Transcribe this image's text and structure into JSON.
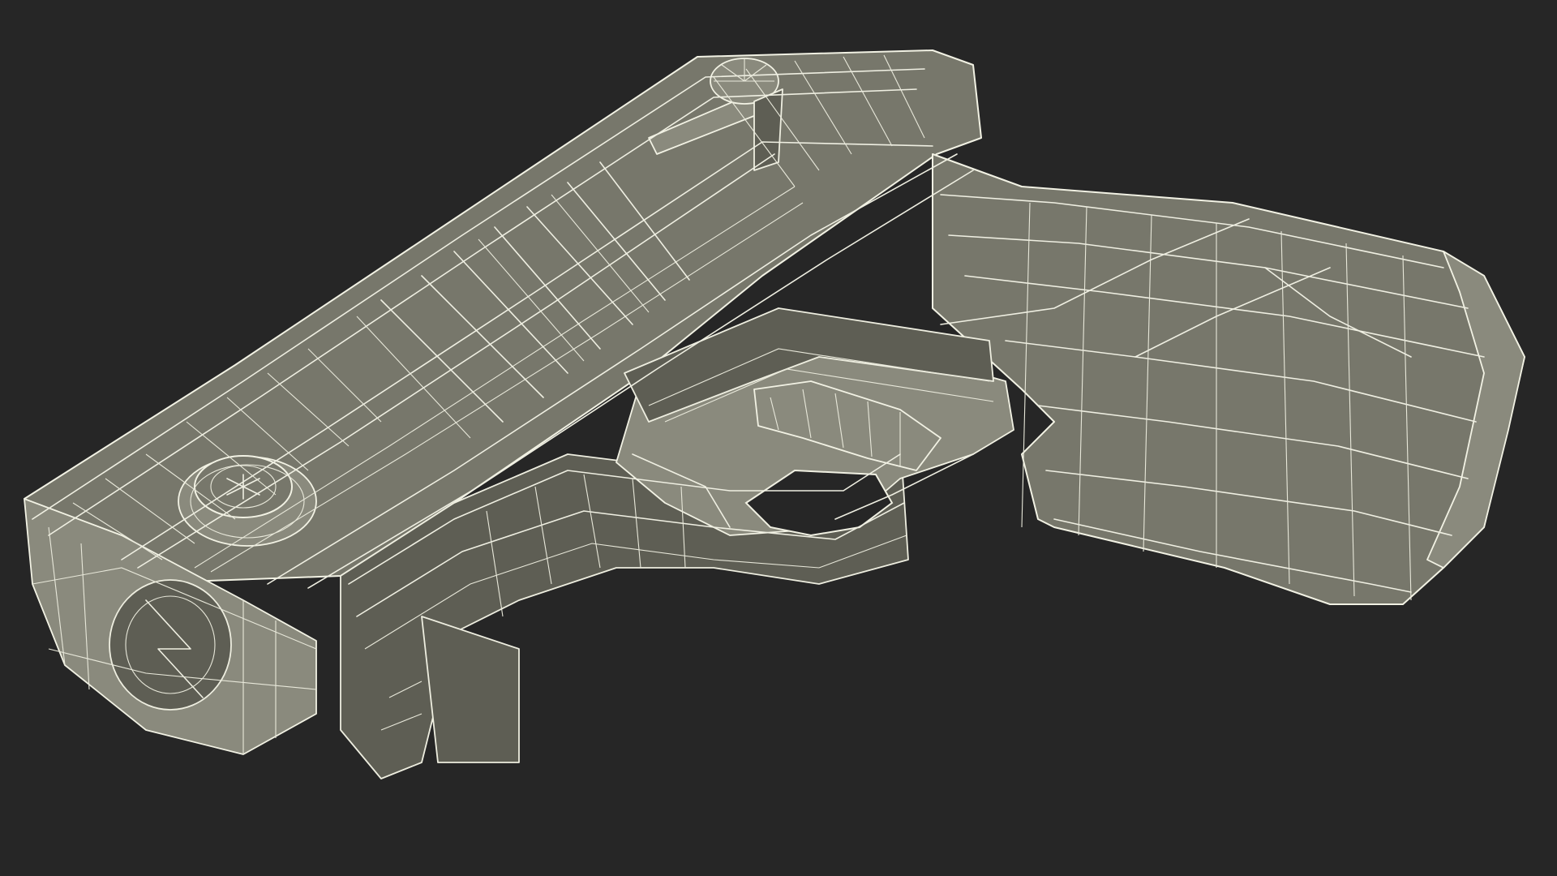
{
  "scene": {
    "subject": "wireframe-3d-model",
    "background_color": "#262626",
    "surface_color": "#77776b",
    "wire_color": "#efefe2"
  }
}
